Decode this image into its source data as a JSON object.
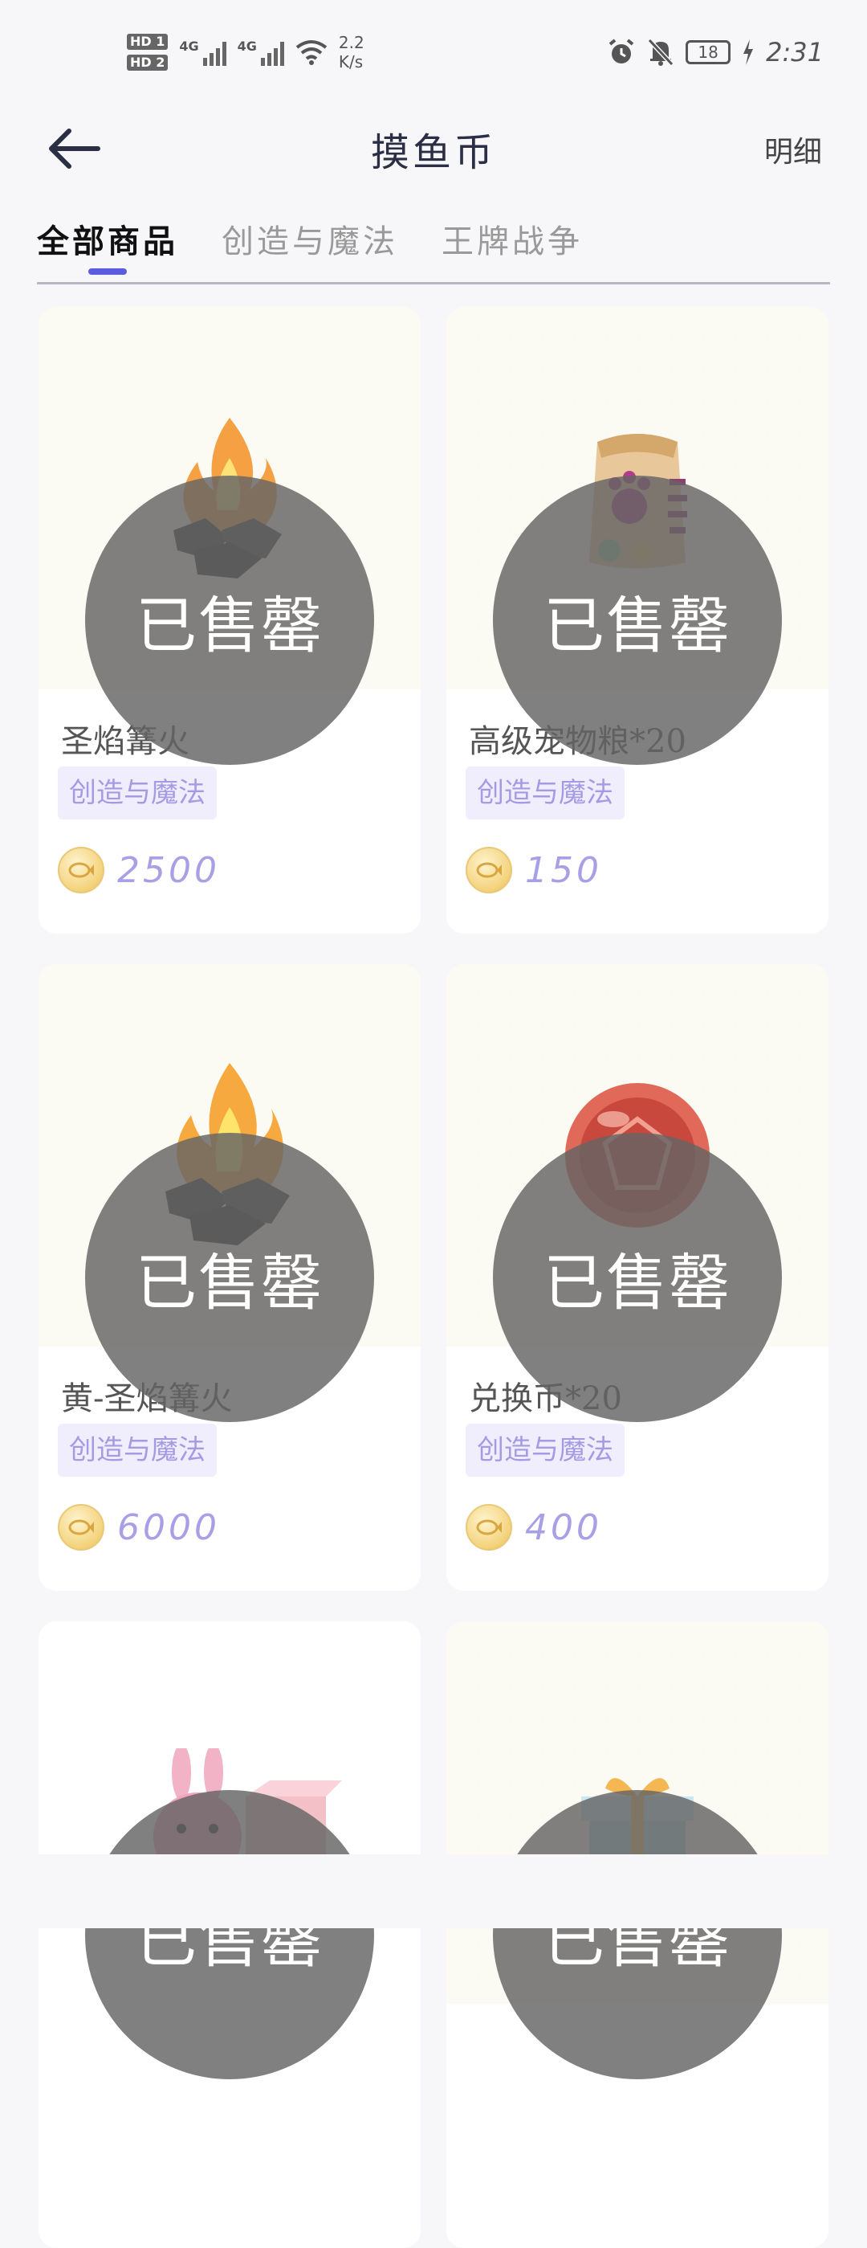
{
  "status": {
    "hd1": "HD 1",
    "hd2": "HD 2",
    "net1": "4G",
    "net2": "4G",
    "speed_value": "2.2",
    "speed_unit": "K/s",
    "battery": "18",
    "time": "2:31"
  },
  "header": {
    "title": "摸鱼币",
    "detail": "明细"
  },
  "tabs": [
    {
      "label": "全部商品",
      "active": true
    },
    {
      "label": "创造与魔法",
      "active": false
    },
    {
      "label": "王牌战争",
      "active": false
    }
  ],
  "soldout_label": "已售罄",
  "products": [
    {
      "name": "圣焰篝火",
      "tag": "创造与魔法",
      "price": "2500",
      "icon": "campfire-icon"
    },
    {
      "name": "高级宠物粮*20",
      "tag": "创造与魔法",
      "price": "150",
      "icon": "pet-food-bag-icon"
    },
    {
      "name": "黄-圣焰篝火",
      "tag": "创造与魔法",
      "price": "6000",
      "icon": "campfire-icon"
    },
    {
      "name": "兑换币*20",
      "tag": "创造与魔法",
      "price": "400",
      "icon": "red-coin-icon"
    }
  ],
  "partial_products": [
    {
      "icon": "bunny-gift-box-icon"
    },
    {
      "icon": "gift-box-icon"
    }
  ],
  "colors": {
    "accent": "#5b5de0",
    "price": "#a7a0e6",
    "tag_bg": "#f0eefc",
    "soldout_overlay": "#646464"
  }
}
